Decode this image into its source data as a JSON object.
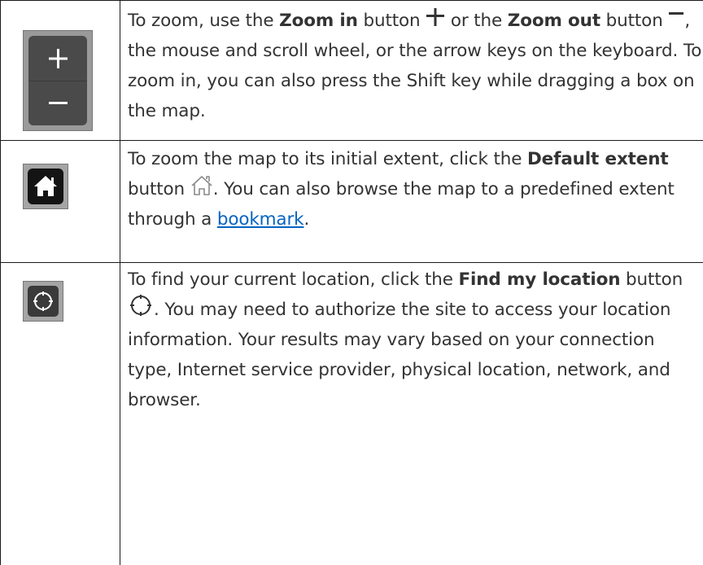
{
  "rows": {
    "zoom": {
      "t1": "To zoom, use the ",
      "b1": "Zoom in",
      "t2": " button ",
      "t3": " or the ",
      "b2": "Zoom out",
      "t4": " button ",
      "t5": ", the mouse and scroll wheel, or the arrow keys on the keyboard. To zoom in, you can also press the Shift key while dragging a box on the map."
    },
    "home": {
      "t1": "To zoom the map to its initial extent, click the ",
      "b1": "Default extent",
      "t2": " button ",
      "t3": ". You can also browse the map to a predefined extent through a ",
      "link": "bookmark",
      "t4": "."
    },
    "locate": {
      "t1": "To find your current location, click the ",
      "b1": "Find my location",
      "t2": " button ",
      "t3": ". You may need to authorize the site to access your location information. Your results may vary based on your connection type, Internet service provider, physical location, network, and browser."
    }
  },
  "icons": {
    "zoom_widget": "zoom-in-out-widget",
    "zoom_in": "plus-icon",
    "zoom_out": "minus-icon",
    "home_widget": "home-widget",
    "home": "home-outline-icon",
    "locate_widget": "locate-widget",
    "locate": "crosshair-circle-icon"
  },
  "colors": {
    "text": "#333333",
    "link": "#0563c1",
    "border": "#1a1a1a"
  }
}
